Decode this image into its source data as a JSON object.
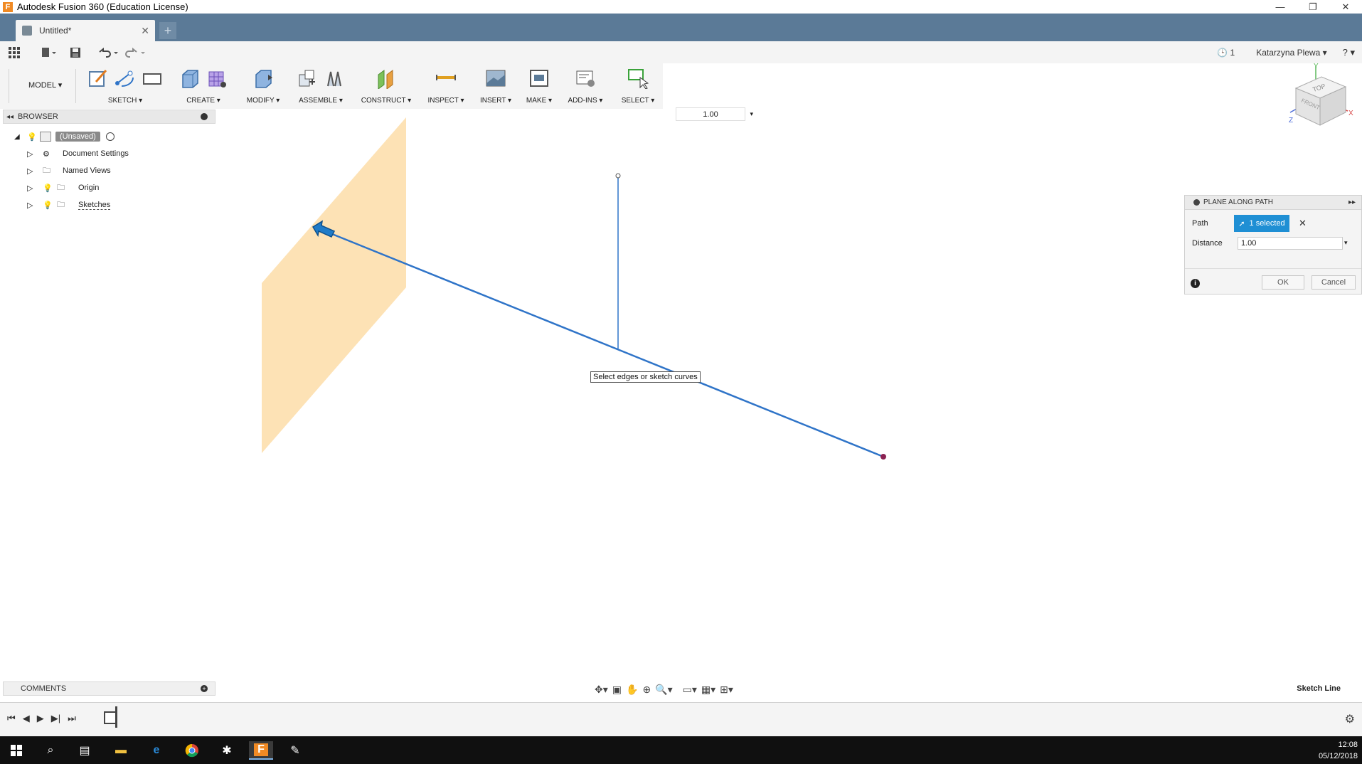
{
  "window": {
    "title": "Autodesk Fusion 360 (Education License)",
    "controls": [
      "—",
      "❐",
      "✕"
    ]
  },
  "tabs": {
    "active_label": "Untitled*",
    "new_tab_glyph": "+"
  },
  "quick_access": {
    "job_count": "1",
    "user_name": "Katarzyna Plewa ▾",
    "help_glyph": "? ▾"
  },
  "toolbar": {
    "workspace": "MODEL ▾",
    "groups": [
      {
        "label": "SKETCH ▾"
      },
      {
        "label": "CREATE ▾"
      },
      {
        "label": "MODIFY ▾"
      },
      {
        "label": "ASSEMBLE ▾"
      },
      {
        "label": "CONSTRUCT ▾"
      },
      {
        "label": "INSPECT ▾"
      },
      {
        "label": "INSERT ▾"
      },
      {
        "label": "MAKE ▾"
      },
      {
        "label": "ADD-INS ▾"
      },
      {
        "label": "SELECT ▾"
      }
    ]
  },
  "browser": {
    "title": "BROWSER",
    "root": "(Unsaved)",
    "items": [
      {
        "label": "Document Settings"
      },
      {
        "label": "Named Views"
      },
      {
        "label": "Origin"
      },
      {
        "label": "Sketches"
      }
    ]
  },
  "viewcube": {
    "top": "TOP",
    "front": "FRONT",
    "axis_y": "Y",
    "axis_x": "X",
    "axis_z": "Z"
  },
  "canvas": {
    "dimension_value": "1.00",
    "tooltip": "Select edges or sketch curves"
  },
  "dialog": {
    "title": "PLANE ALONG PATH",
    "path_label": "Path",
    "path_selection": "1 selected",
    "distance_label": "Distance",
    "distance_value": "1.00",
    "ok_label": "OK",
    "cancel_label": "Cancel"
  },
  "comments": {
    "title": "COMMENTS"
  },
  "status": {
    "text": "Sketch Line"
  },
  "taskbar": {
    "time": "12:08",
    "date": "05/12/2018"
  },
  "colors": {
    "tabbar": "#5b7a97",
    "plane_fill": "#fde2b5",
    "sketch_line": "#2f74c8",
    "selection_blue": "#1f8fd4"
  }
}
